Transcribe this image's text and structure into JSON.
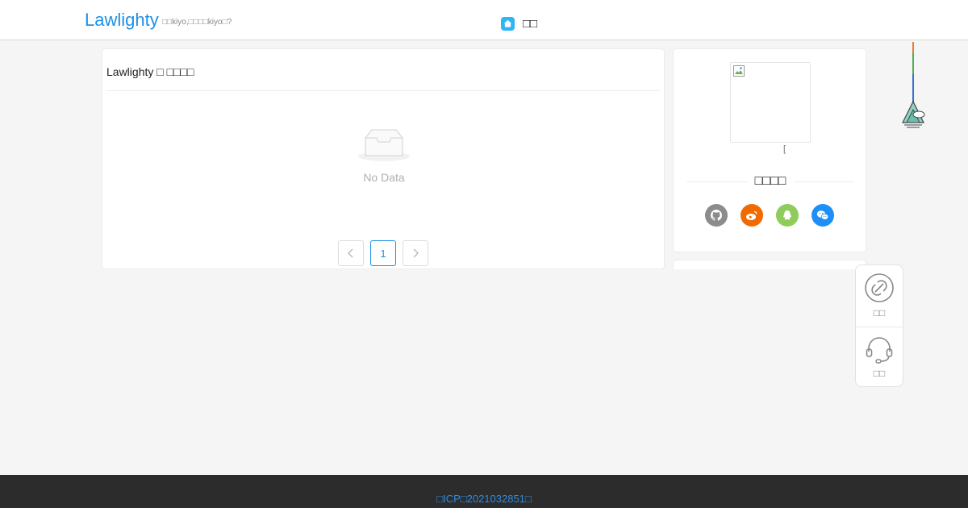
{
  "header": {
    "brand": "Lawlighty",
    "tagline": "□□kiyo,□□□□kiyo□?",
    "nav_home_label": "□□"
  },
  "main": {
    "title": "Lawlighty □ □□□□",
    "empty_text": "No Data",
    "pagination": {
      "prev_icon": "chevron-left-icon",
      "current_page": "1",
      "next_icon": "chevron-right-icon"
    }
  },
  "sidebar": {
    "avatar_caption": "[",
    "contact_title": "□□□□",
    "social": [
      {
        "icon": "github-icon",
        "color": "#8c8c8c"
      },
      {
        "icon": "weibo-icon",
        "color": "#f06a00"
      },
      {
        "icon": "qq-icon",
        "color": "#8fcc5c"
      },
      {
        "icon": "wechat-icon",
        "color": "#1e90f5"
      }
    ]
  },
  "float_panel": {
    "items": [
      {
        "label": "□□",
        "icon": "link-icon"
      },
      {
        "label": "□□",
        "icon": "headset-icon"
      }
    ]
  },
  "footer": {
    "icp": "□ICP□2021032851□"
  },
  "colors": {
    "brand": "#1e90e6",
    "page_bg": "#f5f5f5",
    "footer_bg": "#2c2c2c",
    "link": "#2f8be0"
  }
}
